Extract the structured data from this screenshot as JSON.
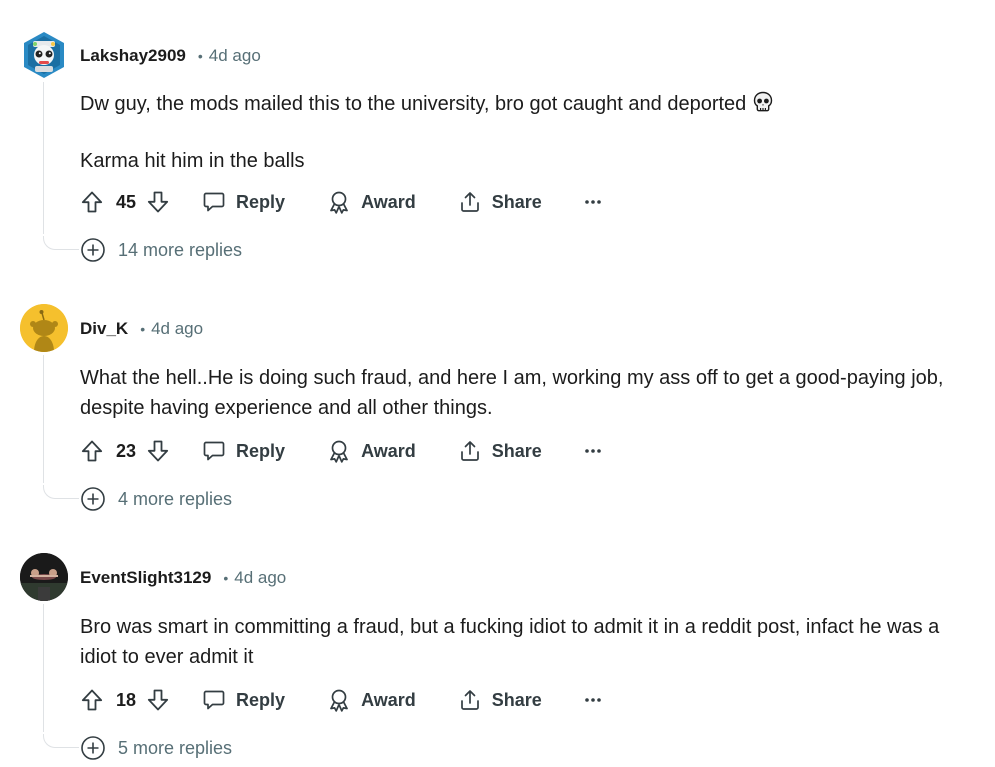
{
  "comments": [
    {
      "username": "Lakshay2909",
      "separator": "•",
      "time": "4d ago",
      "paragraphs": [
        "Dw guy, the mods mailed this to the university, bro got caught and deported",
        "Karma hit him in the balls"
      ],
      "votes": "45",
      "reply_label": "Reply",
      "award_label": "Award",
      "share_label": "Share",
      "more_replies": "14 more replies"
    },
    {
      "username": "Div_K",
      "separator": "•",
      "time": "4d ago",
      "paragraphs": [
        "What the hell..He is doing such fraud, and here I am, working my ass off to get a good-paying job, despite having experience and all other things."
      ],
      "votes": "23",
      "reply_label": "Reply",
      "award_label": "Award",
      "share_label": "Share",
      "more_replies": "4 more replies"
    },
    {
      "username": "EventSlight3129",
      "separator": "•",
      "time": "4d ago",
      "paragraphs": [
        "Bro was smart in committing a fraud, but a fucking idiot to admit it in a reddit post, infact he was a idiot to ever admit it"
      ],
      "votes": "18",
      "reply_label": "Reply",
      "award_label": "Award",
      "share_label": "Share",
      "more_replies": "5 more replies"
    }
  ],
  "icons": {
    "upvote": "upvote-arrow-icon",
    "downvote": "downvote-arrow-icon",
    "reply": "speech-bubble-icon",
    "award": "award-ribbon-icon",
    "share": "share-upload-icon",
    "overflow": "ellipsis-icon",
    "expand": "plus-circle-icon",
    "emoji": "skull-emoji"
  },
  "colors": {
    "text": "#1c1c1c",
    "meta": "#576f76",
    "thread_line": "#dfe2e5",
    "snoo_avatar_bg": "#f5c02d"
  }
}
